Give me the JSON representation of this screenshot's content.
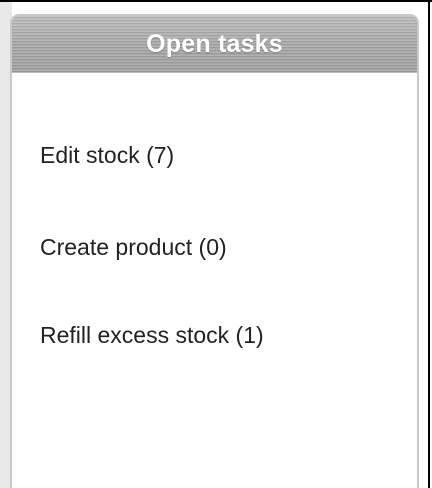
{
  "panel": {
    "title": "Open tasks"
  },
  "tasks": [
    {
      "label": "Edit stock (7)"
    },
    {
      "label": "Create product (0)"
    },
    {
      "label": "Refill excess stock (1)"
    }
  ],
  "colors": {
    "header_gray": "#a8a8a8",
    "title_text": "#ffffff",
    "body_text": "#222222",
    "panel_border": "#c9c9c9"
  }
}
